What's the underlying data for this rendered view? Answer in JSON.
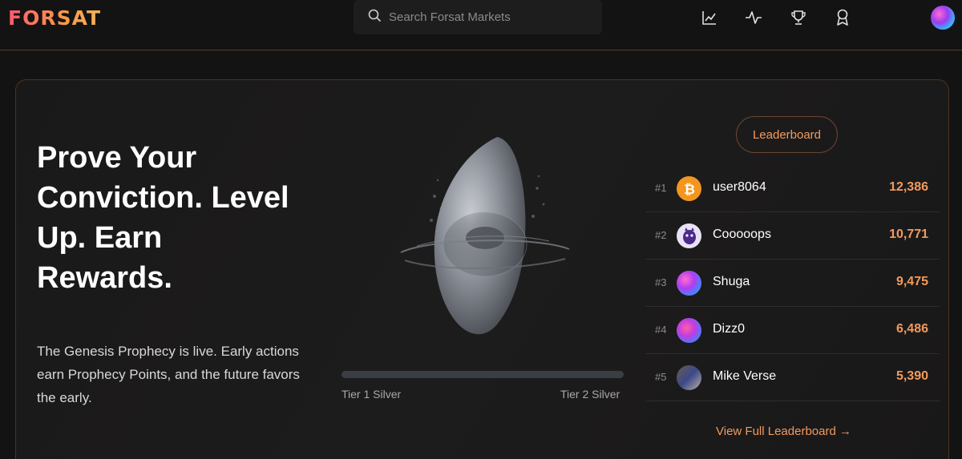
{
  "header": {
    "logo": "FORSAT",
    "search_placeholder": "Search Forsat Markets",
    "nav_icons": [
      "chart-line-icon",
      "activity-icon",
      "trophy-icon",
      "award-icon"
    ]
  },
  "hero": {
    "title": "Prove Your Conviction. Level Up. Earn Rewards.",
    "description": "The Genesis Prophecy is live. Early actions earn Prophecy Points, and the future favors the early."
  },
  "progress": {
    "tier_start": "Tier 1 Silver",
    "tier_end": "Tier 2 Silver",
    "fraction": 0.0
  },
  "leaderboard": {
    "button_label": "Leaderboard",
    "rows": [
      {
        "rank": "#1",
        "name": "user8064",
        "score": "12,386",
        "avatar": "bitcoin-icon"
      },
      {
        "rank": "#2",
        "name": "Cooooops",
        "score": "10,771",
        "avatar": "purple-creature-avatar"
      },
      {
        "rank": "#3",
        "name": "Shuga",
        "score": "9,475",
        "avatar": "gradient-orb-avatar"
      },
      {
        "rank": "#4",
        "name": "Dizz0",
        "score": "6,486",
        "avatar": "gradient-orb-avatar"
      },
      {
        "rank": "#5",
        "name": "Mike Verse",
        "score": "5,390",
        "avatar": "photo-avatar"
      }
    ],
    "view_full": "View Full Leaderboard →"
  },
  "colors": {
    "accent": "#f29a5d",
    "border": "#4d3322",
    "background": "#141313"
  }
}
